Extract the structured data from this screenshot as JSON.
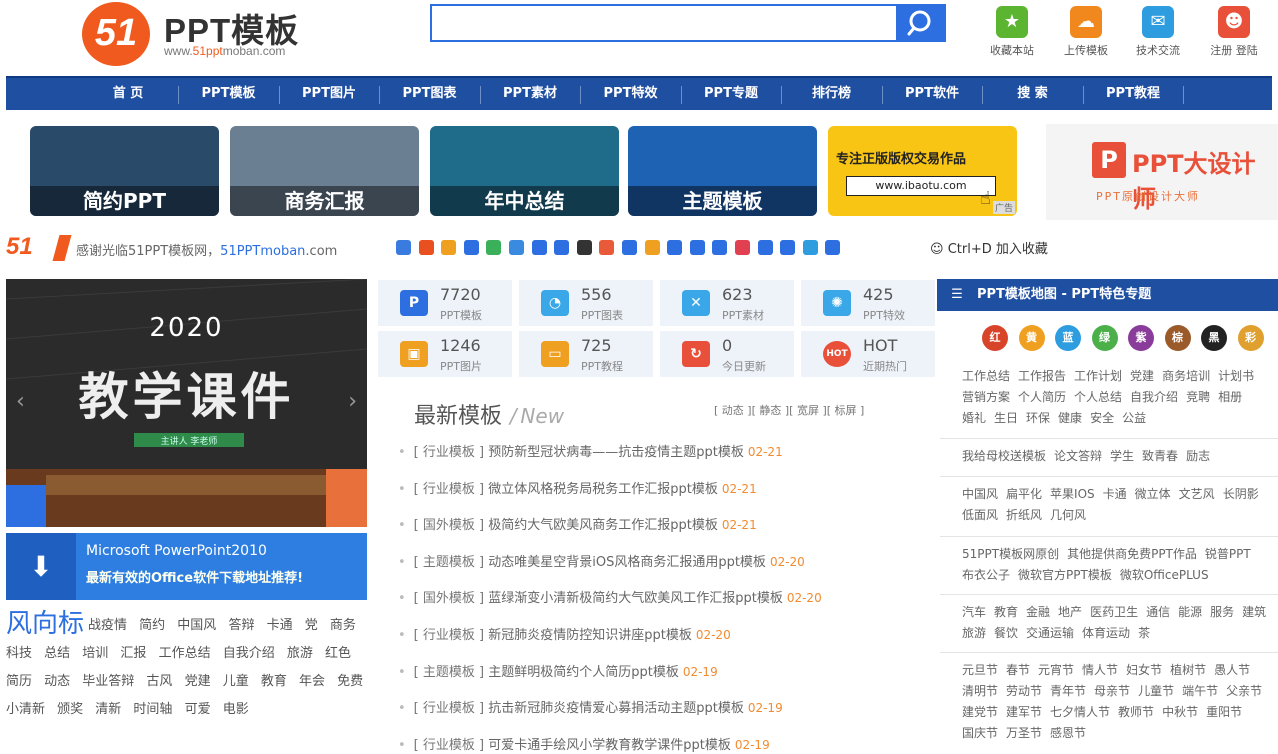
{
  "header": {
    "logo_mark": "51",
    "brand": "PPT模板",
    "url_prefix": "www.",
    "url_brand": "51ppt",
    "url_suffix": "moban.com",
    "search": {
      "placeholder": "",
      "value": ""
    },
    "tools": [
      {
        "label": "收藏本站",
        "icon": "star-icon",
        "color": "#5cb531"
      },
      {
        "label": "上传模板",
        "icon": "upload-cloud-icon",
        "color": "#f0881e"
      },
      {
        "label": "技术交流",
        "icon": "chat-icon",
        "color": "#2d9de0"
      },
      {
        "label": "注册 登陆",
        "icon": "user-icon",
        "color": "#e8503a"
      }
    ]
  },
  "nav": [
    "首 页",
    "PPT模板",
    "PPT图片",
    "PPT图表",
    "PPT素材",
    "PPT特效",
    "PPT专题",
    "排行榜",
    "PPT软件",
    "搜 索",
    "PPT教程"
  ],
  "banners": [
    {
      "label": "简约PPT",
      "color": "#2a4a6a"
    },
    {
      "label": "商务汇报",
      "color": "#6b7f93"
    },
    {
      "label": "年中总结",
      "color": "#1f6b8a"
    },
    {
      "label": "主题模板",
      "color": "#1e62b4"
    },
    {
      "label": "",
      "ad_text": "专注正版版权交易作品",
      "ad_url": "www.ibaotu.com",
      "ad_tag": "广告",
      "color": "#f9c514"
    },
    {
      "label": "",
      "ad_text": "PPT大设计师",
      "ad_sub": "PPT原创设计大师",
      "color": "#f4f4f4"
    }
  ],
  "share_bar": {
    "logo": "51",
    "text_prefix": "感谢光临51PPT模板网，",
    "text_link": "51PPTmoban",
    "text_suffix": ".com",
    "icons": [
      "#3a7be0",
      "#e85020",
      "#f0a020",
      "#2d6fe0",
      "#3ab05a",
      "#3a8be0",
      "#2d6fe0",
      "#2d6fe0",
      "#333",
      "#e85a3a",
      "#2d6fe0",
      "#f0a020",
      "#2d6fe0",
      "#2d6fe0",
      "#2d6fe0",
      "#e04050",
      "#2d6fe0",
      "#2d6fe0",
      "#2d9de0",
      "#2d6fe0"
    ],
    "ctrl_text": "Ctrl+D 加入收藏"
  },
  "featured": {
    "year": "2020",
    "title": "教学课件",
    "ribbon": "主讲人  李老师"
  },
  "office": {
    "title": "Microsoft PowerPoint2010",
    "subtitle": "最新有效的Office软件下载地址推荐!"
  },
  "wind": {
    "title": "风向标",
    "tags": [
      "战疫情",
      "简约",
      "中国风",
      "答辩",
      "卡通",
      "党",
      "商务",
      "科技",
      "总结",
      "培训",
      "汇报",
      "工作总结",
      "自我介绍",
      "旅游",
      "红色",
      "简历",
      "动态",
      "毕业答辩",
      "古风",
      "党建",
      "儿童",
      "教育",
      "年会",
      "免费",
      "小清新",
      "颁奖",
      "清新",
      "时间轴",
      "可爱",
      "电影"
    ]
  },
  "stats": [
    {
      "n": "7720",
      "l": "PPT模板",
      "icon": "ppt-icon",
      "color": "#2d6fe0",
      "glyph": "P"
    },
    {
      "n": "556",
      "l": "PPT图表",
      "icon": "pie-chart-icon",
      "color": "#3aa8e8",
      "glyph": "◔"
    },
    {
      "n": "623",
      "l": "PPT素材",
      "icon": "tools-icon",
      "color": "#3aa8e8",
      "glyph": "✕"
    },
    {
      "n": "425",
      "l": "PPT特效",
      "icon": "spinner-icon",
      "color": "#3aa8e8",
      "glyph": "✺"
    },
    {
      "n": "1246",
      "l": "PPT图片",
      "icon": "image-icon",
      "color": "#f0a020",
      "glyph": "▣"
    },
    {
      "n": "725",
      "l": "PPT教程",
      "icon": "board-icon",
      "color": "#f0a020",
      "glyph": "▭"
    },
    {
      "n": "0",
      "l": "今日更新",
      "icon": "refresh-icon",
      "color": "#e8503a",
      "glyph": "↻"
    },
    {
      "n": "HOT",
      "l": "近期热门",
      "icon": "hot-icon",
      "color": "#e8503a",
      "glyph": "HOT"
    }
  ],
  "latest": {
    "title": "最新模板",
    "slash": "/",
    "new_label": "New",
    "filters": [
      "[ 动态 ]",
      "[ 静态 ]",
      "[ 宽屏 ]",
      "[ 标屏 ]"
    ],
    "items": [
      {
        "cat": "[ 行业模板 ]",
        "title": "预防新型冠状病毒——抗击疫情主题ppt模板",
        "date": "02-21"
      },
      {
        "cat": "[ 行业模板 ]",
        "title": "微立体风格税务局税务工作汇报ppt模板",
        "date": "02-21"
      },
      {
        "cat": "[ 国外模板 ]",
        "title": "极简约大气欧美风商务工作汇报ppt模板",
        "date": "02-21"
      },
      {
        "cat": "[ 主题模板 ]",
        "title": "动态唯美星空背景iOS风格商务汇报通用ppt模板",
        "date": "02-20"
      },
      {
        "cat": "[ 国外模板 ]",
        "title": "蓝绿渐变小清新极简约大气欧美风工作汇报ppt模板",
        "date": "02-20"
      },
      {
        "cat": "[ 行业模板 ]",
        "title": "新冠肺炎疫情防控知识讲座ppt模板",
        "date": "02-20"
      },
      {
        "cat": "[ 主题模板 ]",
        "title": "主题鲜明极简约个人简历ppt模板",
        "date": "02-19"
      },
      {
        "cat": "[ 行业模板 ]",
        "title": "抗击新冠肺炎疫情爱心募捐活动主题ppt模板",
        "date": "02-19"
      },
      {
        "cat": "[ 行业模板 ]",
        "title": "可爱卡通手绘风小学教育教学课件ppt模板",
        "date": "02-19"
      }
    ]
  },
  "map": {
    "title": "PPT模板地图 - PPT特色专题",
    "colors": [
      {
        "c": "#d8442a",
        "t": "红"
      },
      {
        "c": "#f0a020",
        "t": "黄"
      },
      {
        "c": "#2d9de0",
        "t": "蓝"
      },
      {
        "c": "#4cb04a",
        "t": "绿"
      },
      {
        "c": "#8a3c9a",
        "t": "紫"
      },
      {
        "c": "#9a5a2a",
        "t": "棕"
      },
      {
        "c": "#222222",
        "t": "黑"
      },
      {
        "c": "#e0a030",
        "t": "彩"
      }
    ],
    "groups": [
      [
        "工作总结",
        "工作报告",
        "工作计划",
        "党建",
        "商务培训",
        "计划书",
        "营销方案",
        "个人简历",
        "个人总结",
        "自我介绍",
        "竞聘",
        "相册",
        "婚礼",
        "生日",
        "环保",
        "健康",
        "安全",
        "公益"
      ],
      [
        "我给母校送模板",
        "论文答辩",
        "学生",
        "致青春",
        "励志"
      ],
      [
        "中国风",
        "扁平化",
        "苹果IOS",
        "卡通",
        "微立体",
        "文艺风",
        "长阴影",
        "低面风",
        "折纸风",
        "几何风"
      ],
      [
        "51PPT模板网原创",
        "其他提供商免费PPT作品",
        "锐普PPT",
        "布衣公子",
        "微软官方PPT模板",
        "微软OfficePLUS"
      ],
      [
        "汽车",
        "教育",
        "金融",
        "地产",
        "医药卫生",
        "通信",
        "能源",
        "服务",
        "建筑",
        "旅游",
        "餐饮",
        "交通运输",
        "体育运动",
        "茶"
      ],
      [
        "元旦节",
        "春节",
        "元宵节",
        "情人节",
        "妇女节",
        "植树节",
        "愚人节",
        "清明节",
        "劳动节",
        "青年节",
        "母亲节",
        "儿童节",
        "端午节",
        "父亲节",
        "建党节",
        "建军节",
        "七夕情人节",
        "教师节",
        "中秋节",
        "重阳节",
        "国庆节",
        "万圣节",
        "感恩节"
      ]
    ]
  }
}
